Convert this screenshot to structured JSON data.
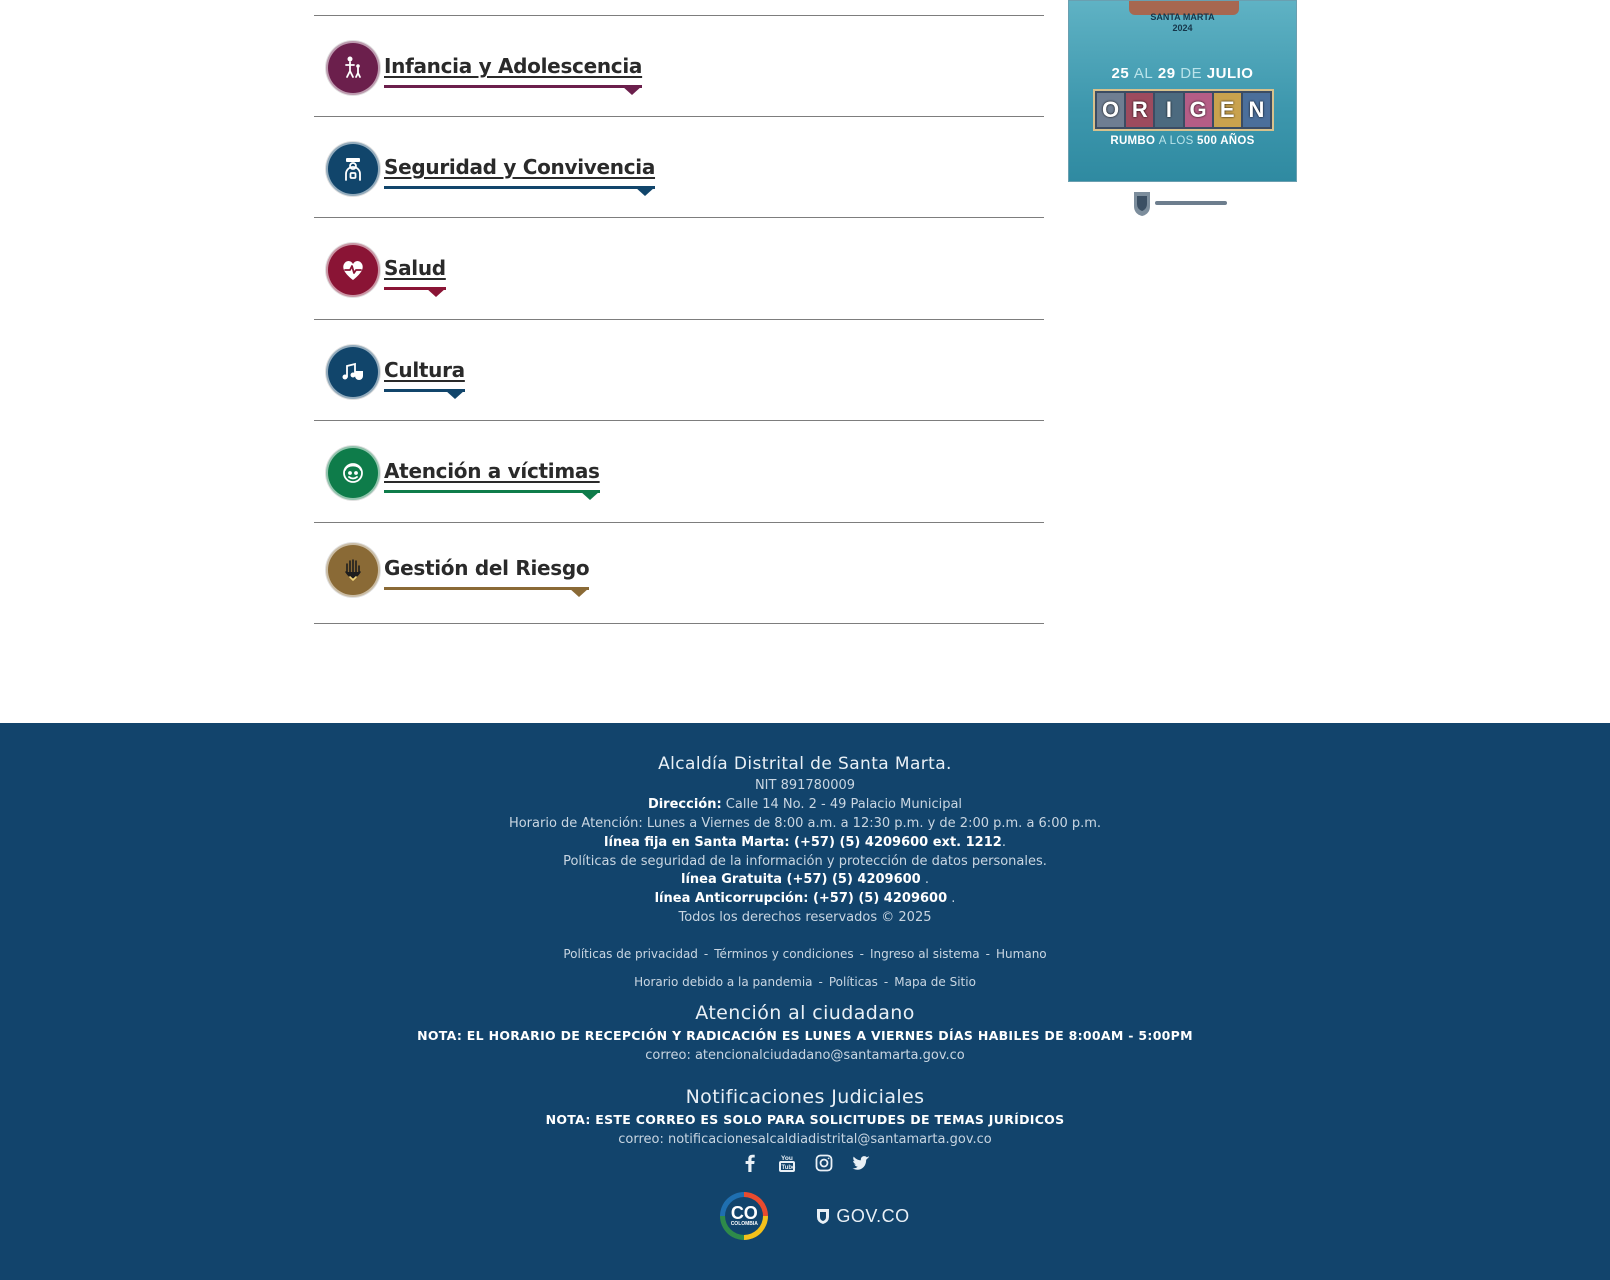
{
  "sections": [
    {
      "id": "infancia",
      "title": "Infancia y Adolescencia",
      "color": "#6b1f4c",
      "icon": "children-icon"
    },
    {
      "id": "seguridad",
      "title": "Seguridad y Convivencia",
      "color": "#11456b",
      "icon": "police-officer-icon"
    },
    {
      "id": "salud",
      "title": "Salud",
      "color": "#8a1435",
      "icon": "heart-pulse-icon"
    },
    {
      "id": "cultura",
      "title": "Cultura",
      "color": "#11456b",
      "icon": "music-theater-icon"
    },
    {
      "id": "victimas",
      "title": "Atención a víctimas",
      "color": "#0e7c4a",
      "icon": "victim-face-icon"
    },
    {
      "id": "riesgo",
      "title": "Gestión del Riesgo",
      "color": "#8a6a36",
      "icon": "hand-shield-icon"
    }
  ],
  "poster": {
    "city": "SANTA MARTA",
    "year": "2024",
    "dates_start": "25",
    "dates_al": "AL",
    "dates_end": "29",
    "dates_de": "DE",
    "dates_month": "JULIO",
    "word_letters": [
      "O",
      "R",
      "I",
      "G",
      "E",
      "N"
    ],
    "tag_a": "RUMBO",
    "tag_b": "A LOS",
    "tag_c": "500 AÑOS"
  },
  "footer": {
    "org_name": "Alcaldía Distrital de Santa Marta.",
    "nit": "NIT 891780009",
    "address_label": "Dirección:",
    "address_value": " Calle 14 No. 2 - 49 Palacio Municipal",
    "hours": "Horario de Atención: Lunes a Viernes de 8:00 a.m. a 12:30 p.m. y de 2:00 p.m. a 6:00 p.m.",
    "landline": "línea fija en Santa Marta: (+57) (5) 4209600 ext. 1212",
    "landline_end": ".",
    "privacy_policy": "Políticas de seguridad de la información y protección de datos personales.",
    "free_line": "línea Gratuita (+57) (5) 4209600",
    "free_line_end": " .",
    "anticorruption": "línea Anticorrupción: (+57) (5) 4209600",
    "anticorruption_end": " .",
    "rights": "Todos los derechos reservados © 2025",
    "links_row1": [
      "Políticas de privacidad",
      "Términos y condiciones",
      "Ingreso al sistema",
      "Humano"
    ],
    "links_row2": [
      "Horario debido a la pandemia",
      "Políticas",
      "Mapa de Sitio"
    ],
    "citizen_heading": "Atención al ciudadano",
    "citizen_note": "NOTA: EL HORARIO DE RECEPCIÓN Y RADICACIÓN ES LUNES A VIERNES DÍAS HABILES DE 8:00AM - 5:00PM",
    "citizen_email": "correo: atencionalciudadano@santamarta.gov.co",
    "judicial_heading": "Notificaciones Judiciales",
    "judicial_note": "NOTA: ESTE CORREO ES SOLO PARA SOLICITUDES DE TEMAS JURÍDICOS",
    "judicial_email": "correo: notificacionesalcaldiadistrital@santamarta.gov.co",
    "social": [
      "facebook-icon",
      "youtube-icon",
      "instagram-icon",
      "twitter-icon"
    ],
    "co_badge_text": "CO",
    "co_badge_sub": "COLOMBIA",
    "gov_text": "GOV.CO"
  }
}
